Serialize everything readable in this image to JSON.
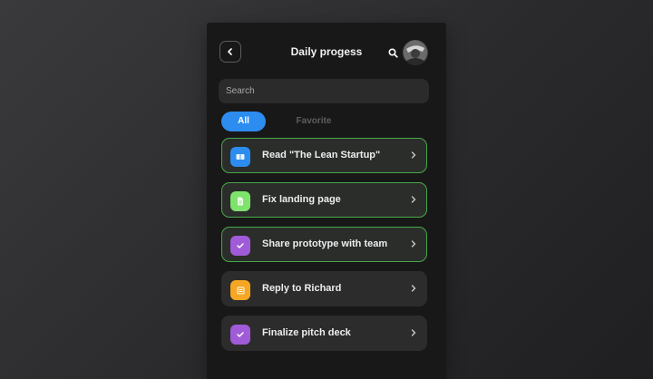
{
  "header": {
    "title": "Daily progess",
    "back_icon": "chevron-left-icon",
    "search_icon": "search-icon"
  },
  "search": {
    "placeholder": "Search",
    "value": ""
  },
  "tabs": [
    {
      "label": "All",
      "active": true
    },
    {
      "label": "Favorite",
      "active": false
    }
  ],
  "tasks": [
    {
      "label": "Read \"The Lean Startup\"",
      "icon": "book-icon",
      "icon_color": "#2d8cf0",
      "completed": true
    },
    {
      "label": "Fix landing page",
      "icon": "document-icon",
      "icon_color": "#7ee36c",
      "completed": true
    },
    {
      "label": "Share prototype with team",
      "icon": "check-icon",
      "icon_color": "#a05bd8",
      "completed": true
    },
    {
      "label": "Reply to Richard",
      "icon": "note-icon",
      "icon_color": "#f5a623",
      "completed": false
    },
    {
      "label": "Finalize pitch deck",
      "icon": "check-icon",
      "icon_color": "#a05bd8",
      "completed": false
    }
  ],
  "colors": {
    "accent": "#2d8cf0",
    "completed_border": "#47a84a",
    "background": "#181818"
  }
}
